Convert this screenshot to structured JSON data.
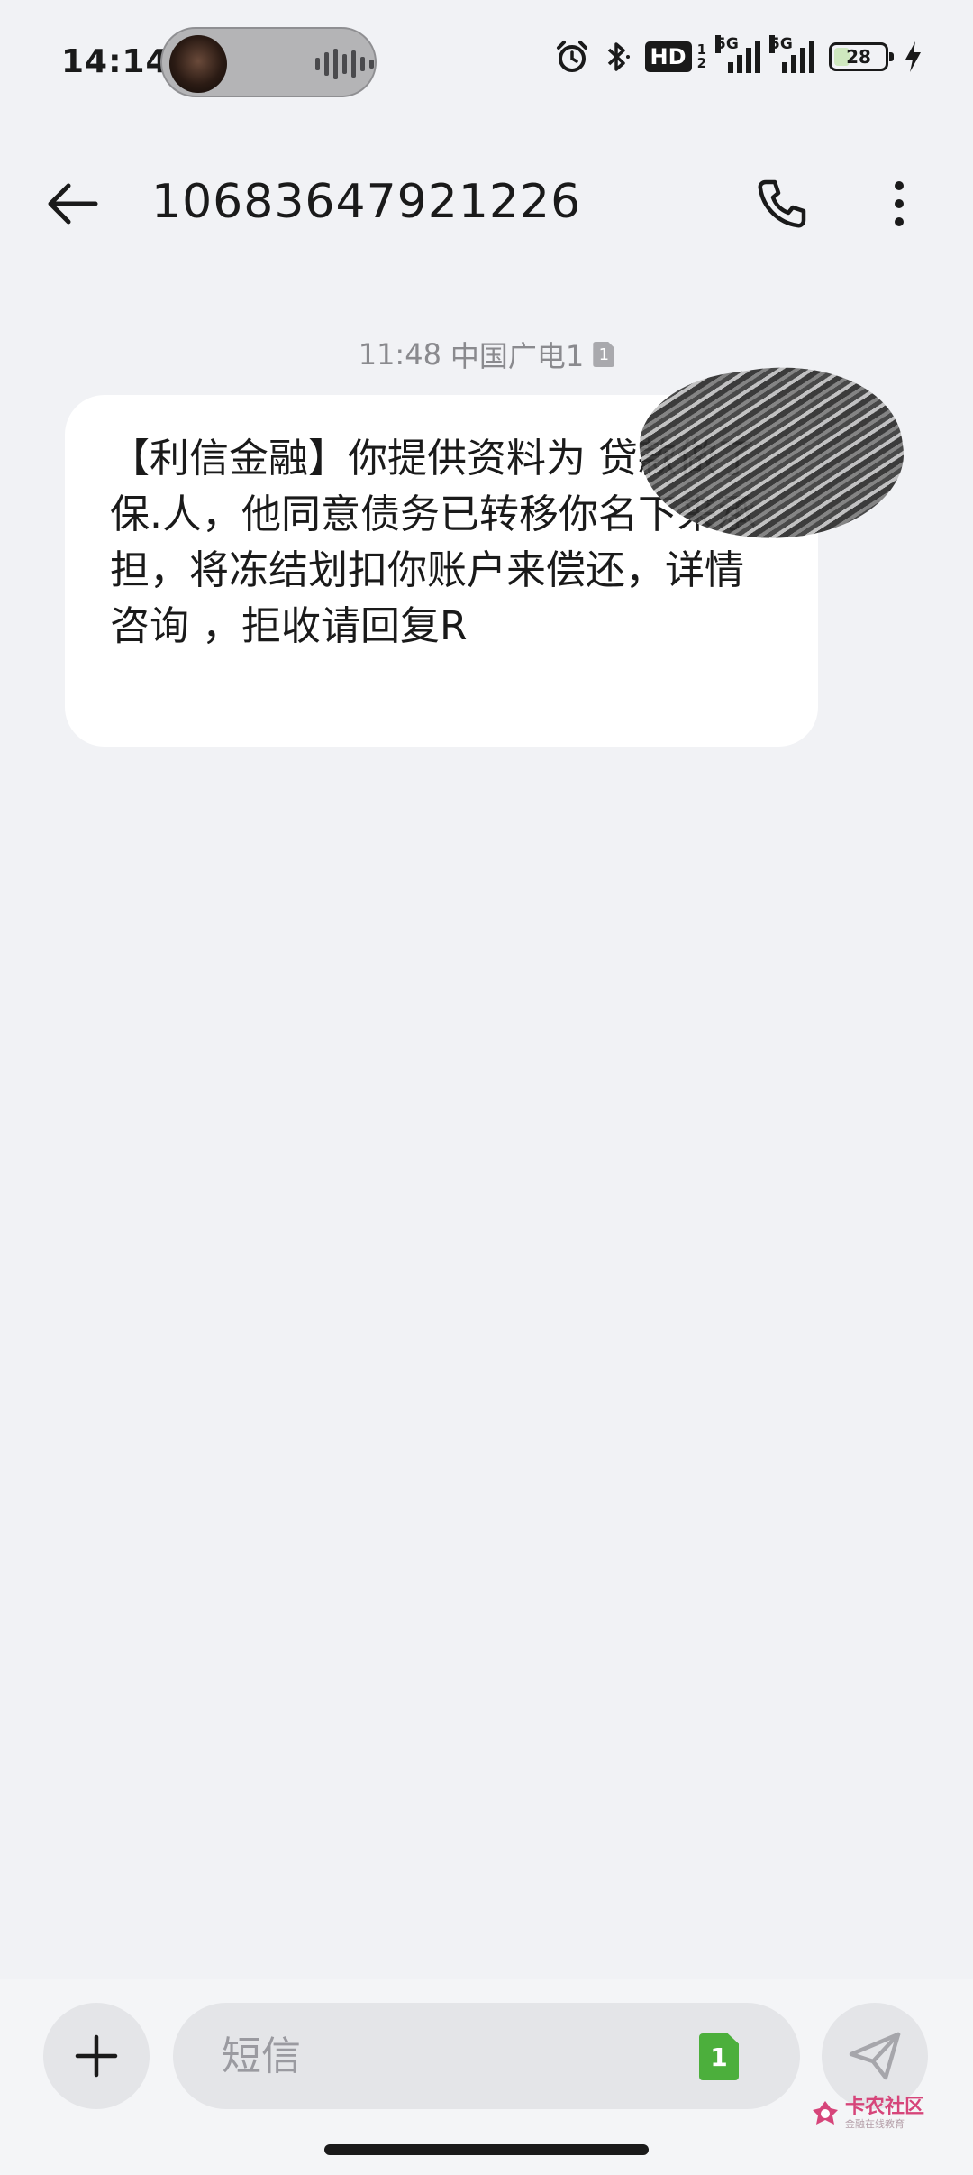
{
  "status_bar": {
    "time": "14:14",
    "hd_label": "HD",
    "hd_sub_top": "1",
    "hd_sub_bottom": "2",
    "network_1": "5G",
    "network_2": "5G",
    "battery_level": "28",
    "icons": [
      "alarm-icon",
      "bluetooth-icon",
      "hd-icon",
      "signal-icon",
      "signal-icon",
      "battery-icon",
      "charging-icon"
    ]
  },
  "header": {
    "contact": "10683647921226",
    "back_icon": "arrow-left-icon",
    "call_icon": "phone-icon",
    "more_icon": "more-vertical-icon"
  },
  "message": {
    "time": "11:48",
    "carrier": "中国广电1",
    "sim_slot": "1",
    "body": "【利信金融】你提供资料为 贷款做了保.人，他同意债务已转移你名下来承担，将冻结划扣你账户来偿还，详情咨询 ，拒收请回复R"
  },
  "compose": {
    "placeholder": "短信",
    "sim_slot": "1",
    "add_icon": "plus-icon",
    "send_icon": "send-icon"
  },
  "watermark": {
    "title": "卡农社区",
    "subtitle": "金融在线教育"
  },
  "colors": {
    "background": "#f1f2f5",
    "bubble": "#ffffff",
    "sim_chip": "#4caf3c",
    "watermark": "#d6457a"
  }
}
